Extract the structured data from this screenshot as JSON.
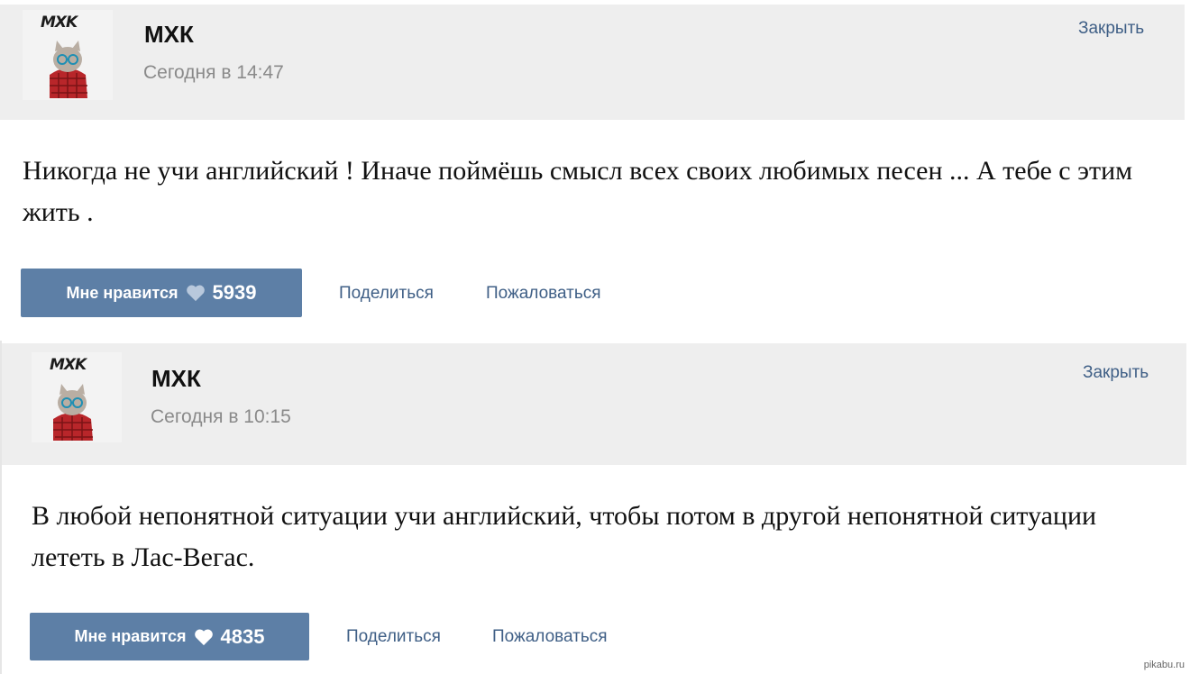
{
  "posts": [
    {
      "avatar_logo": "MXK",
      "author": "МХК",
      "time": "Сегодня в 14:47",
      "close_label": "Закрыть",
      "text": "Никогда не учи английский ! Иначе поймёшь смысл всех своих любимых песен ... А тебе с этим жить .",
      "like_label": "Мне нравится",
      "like_count": "5939",
      "heart_color": "#b8c8dc",
      "share_label": "Поделиться",
      "report_label": "Пожаловаться"
    },
    {
      "avatar_logo": "MXK",
      "author": "МХК",
      "time": "Сегодня в 10:15",
      "close_label": "Закрыть",
      "text": "В любой непонятной ситуации учи английский, чтобы потом в другой непонятной ситуации лететь в Лас-Вегас.",
      "like_label": "Мне нравится",
      "like_count": "4835",
      "heart_color": "#ffffff",
      "share_label": "Поделиться",
      "report_label": "Пожаловаться"
    }
  ],
  "watermark": "pikabu.ru",
  "colors": {
    "header_bg": "#eeeeee",
    "like_button_bg": "#5d7fa6",
    "link": "#3f5f86",
    "time_text": "#8a8a8a"
  }
}
